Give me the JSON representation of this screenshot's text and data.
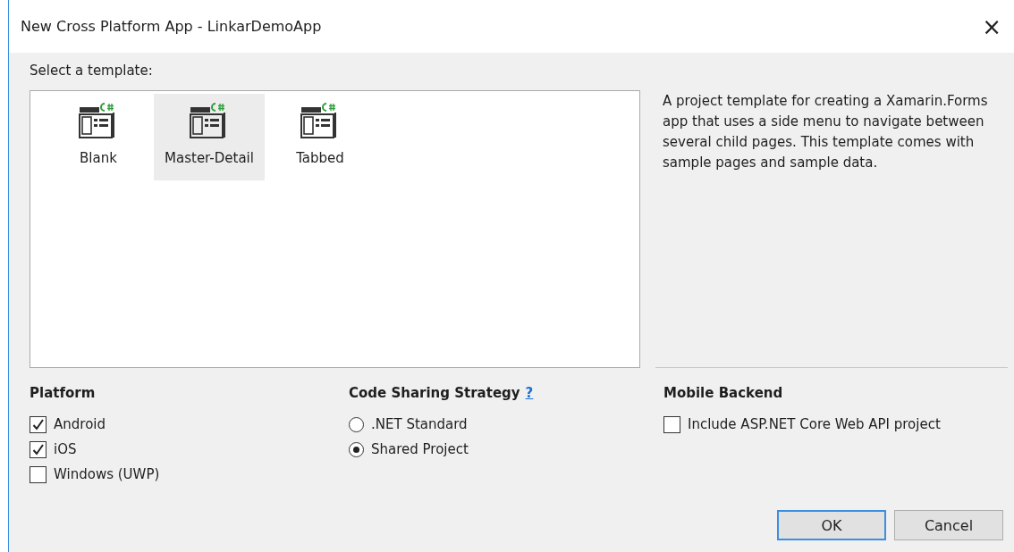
{
  "window": {
    "title": "New Cross Platform App - LinkarDemoApp",
    "close": "×"
  },
  "template_label": "Select a template:",
  "templates": [
    {
      "label": "Blank",
      "selected": false
    },
    {
      "label": "Master-Detail",
      "selected": true
    },
    {
      "label": "Tabbed",
      "selected": false
    }
  ],
  "description": "A project template for creating a Xamarin.Forms app that uses a side menu to navigate between several child pages. This template comes with sample pages and sample data.",
  "platform": {
    "heading": "Platform",
    "options": [
      {
        "label": "Android",
        "checked": true
      },
      {
        "label": "iOS",
        "checked": true
      },
      {
        "label": "Windows (UWP)",
        "checked": false
      }
    ]
  },
  "code_sharing": {
    "heading": "Code Sharing Strategy",
    "help": "?",
    "options": [
      {
        "label": ".NET Standard",
        "selected": false
      },
      {
        "label": "Shared Project",
        "selected": true
      }
    ]
  },
  "mobile_backend": {
    "heading": "Mobile Backend",
    "options": [
      {
        "label": "Include ASP.NET Core Web API project",
        "checked": false
      }
    ]
  },
  "buttons": [
    {
      "label": "OK",
      "kind": "default"
    },
    {
      "label": "Cancel",
      "kind": "normal"
    }
  ]
}
